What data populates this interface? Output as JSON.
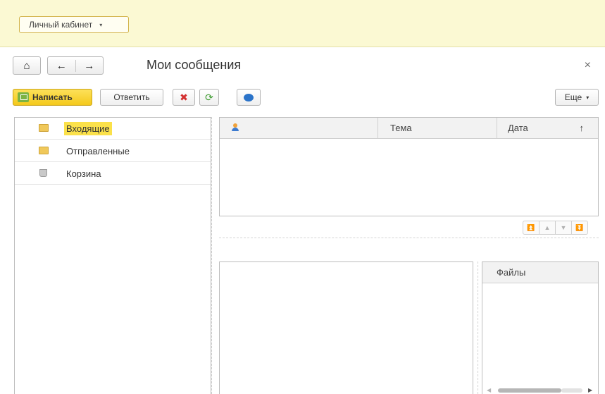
{
  "topbar": {
    "cabinet_label": "Личный кабинет",
    "caret": "▾"
  },
  "nav": {
    "home_glyph": "⌂",
    "back_glyph": "←",
    "forward_glyph": "→",
    "title": "Мои сообщения",
    "close_glyph": "×"
  },
  "toolbar": {
    "write_label": "Написать",
    "reply_label": "Ответить",
    "delete_glyph": "✖",
    "refresh_glyph": "⟳",
    "more_label": "Еще",
    "more_caret": "▾"
  },
  "folders": [
    {
      "label": "Входящие",
      "icon": "folder-inbox-icon",
      "active": true
    },
    {
      "label": "Отправленные",
      "icon": "folder-sent-icon",
      "active": false
    },
    {
      "label": "Корзина",
      "icon": "trash-icon",
      "active": false
    }
  ],
  "message_list": {
    "columns": {
      "theme": "Тема",
      "date": "Дата",
      "sort_glyph": "↑"
    },
    "rows": []
  },
  "pager": {
    "first": "⏫",
    "prev": "▲",
    "next": "▼",
    "last": "⏬"
  },
  "files": {
    "header": "Файлы"
  },
  "colors": {
    "topbar_bg": "#fbf9d3",
    "accent": "#f4c91b",
    "selection": "#fbe14a"
  }
}
